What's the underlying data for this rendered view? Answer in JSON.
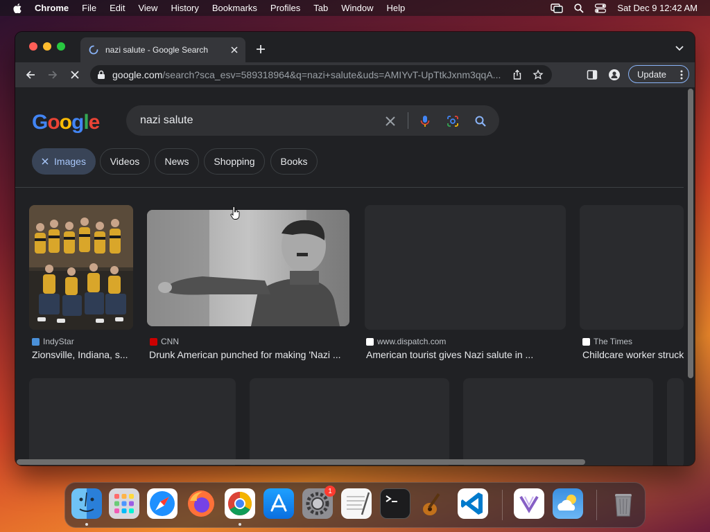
{
  "menubar": {
    "app": "Chrome",
    "items": [
      "File",
      "Edit",
      "View",
      "History",
      "Bookmarks",
      "Profiles",
      "Tab",
      "Window",
      "Help"
    ],
    "datetime": "Sat Dec 9  12:42 AM"
  },
  "browser": {
    "tab_title": "nazi salute - Google Search",
    "url_host": "google.com",
    "url_path": "/search?sca_esv=589318964&q=nazi+salute&uds=AMIYvT-UpTtkJxnm3qqA...",
    "update_label": "Update"
  },
  "google": {
    "logo": "Google",
    "query": "nazi salute",
    "chips": [
      "Images",
      "Videos",
      "News",
      "Shopping",
      "Books"
    ],
    "active_chip": "Images",
    "results": [
      {
        "source": "IndyStar",
        "caption": "Zionsville, Indiana, s...",
        "fav_color": "#4a90d9"
      },
      {
        "source": "CNN",
        "caption": "Drunk American punched for making 'Nazi ...",
        "fav_color": "#cc0000"
      },
      {
        "source": "www.dispatch.com",
        "caption": "American tourist gives Nazi salute in ...",
        "fav_color": "#ffffff"
      },
      {
        "source": "The Times",
        "caption": "Childcare worker struck",
        "fav_color": "#ffffff"
      }
    ]
  },
  "dock": {
    "apps": [
      "finder",
      "launchpad",
      "safari",
      "firefox",
      "chrome",
      "app-store",
      "system-settings",
      "textedit",
      "terminal",
      "garageband",
      "vscode",
      "visual-studio",
      "weather",
      "trash"
    ],
    "settings_badge": "1"
  }
}
